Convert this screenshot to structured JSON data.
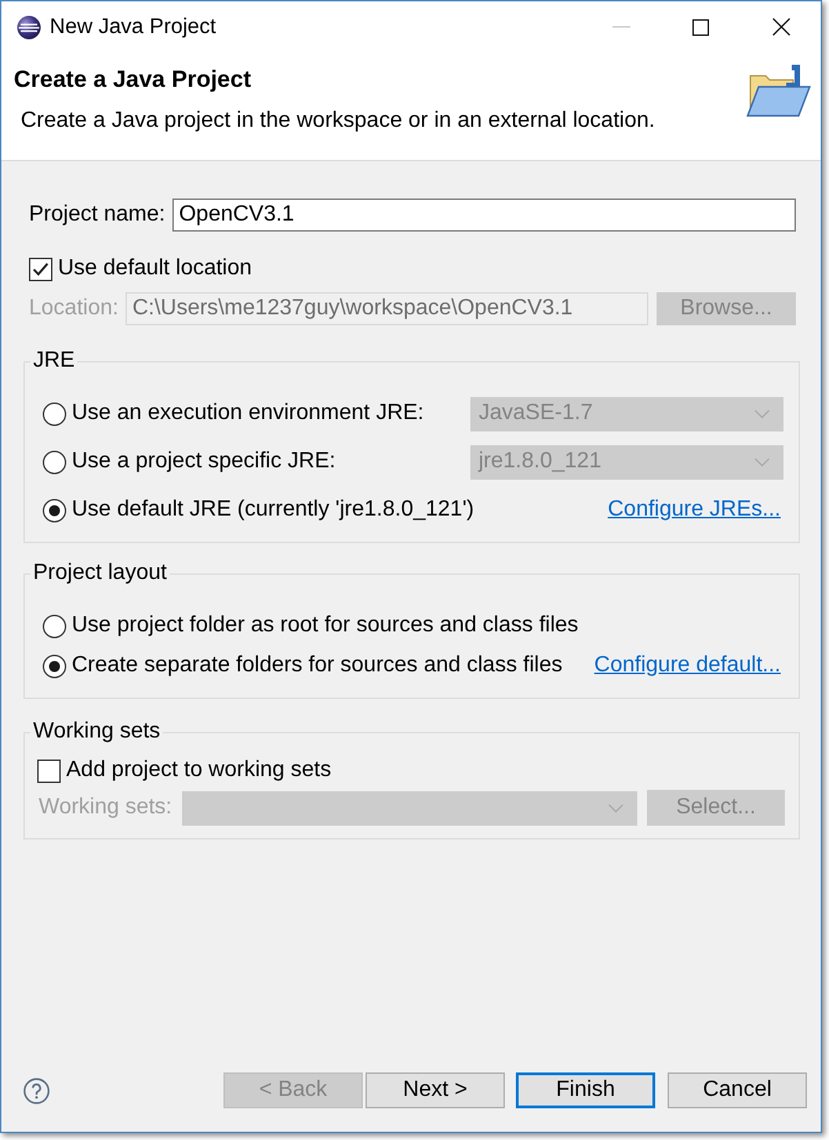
{
  "window": {
    "title": "New Java Project",
    "controls": [
      {
        "kind": "minimize",
        "disabled": true
      },
      {
        "kind": "maximize",
        "disabled": false
      },
      {
        "kind": "close",
        "disabled": false
      }
    ]
  },
  "header": {
    "title": "Create a Java Project",
    "description": "Create a Java project in the workspace or in an external location."
  },
  "project_name": {
    "label": "Project name:",
    "value": "OpenCV3.1"
  },
  "default_location": {
    "label": "Use default location",
    "checked": true
  },
  "location": {
    "label": "Location:",
    "value": "C:\\Users\\me1237guy\\workspace\\OpenCV3.1",
    "disabled": true,
    "button": {
      "label": "Browse...",
      "disabled": true
    }
  },
  "groups": [
    {
      "title": "JRE",
      "rows": [
        {
          "kind": "radio",
          "label": "Use an execution environment JRE:",
          "selected": false,
          "dropdown": {
            "value": "JavaSE-1.7",
            "disabled": true
          }
        },
        {
          "kind": "radio",
          "label": "Use a project specific JRE:",
          "selected": false,
          "dropdown": {
            "value": "jre1.8.0_121",
            "disabled": true
          }
        },
        {
          "kind": "radio",
          "label": "Use default JRE (currently 'jre1.8.0_121')",
          "selected": true,
          "link": "Configure JREs..."
        }
      ]
    },
    {
      "title": "Project layout",
      "rows": [
        {
          "kind": "radio",
          "label": "Use project folder as root for sources and class files",
          "selected": false
        },
        {
          "kind": "radio",
          "label": "Create separate folders for sources and class files",
          "selected": true,
          "link": "Configure default..."
        }
      ]
    },
    {
      "title": "Working sets",
      "rows": [
        {
          "kind": "checkbox",
          "label": "Add project to working sets",
          "checked": false
        },
        {
          "kind": "combo",
          "label": "Working sets:",
          "disabled": true,
          "button": {
            "label": "Select...",
            "disabled": true
          }
        }
      ]
    }
  ],
  "buttons": [
    {
      "label": "< Back",
      "disabled": true,
      "default": false
    },
    {
      "label": "Next >",
      "disabled": false,
      "default": false
    },
    {
      "label": "Finish",
      "disabled": false,
      "default": true
    },
    {
      "label": "Cancel",
      "disabled": false,
      "default": false
    }
  ]
}
